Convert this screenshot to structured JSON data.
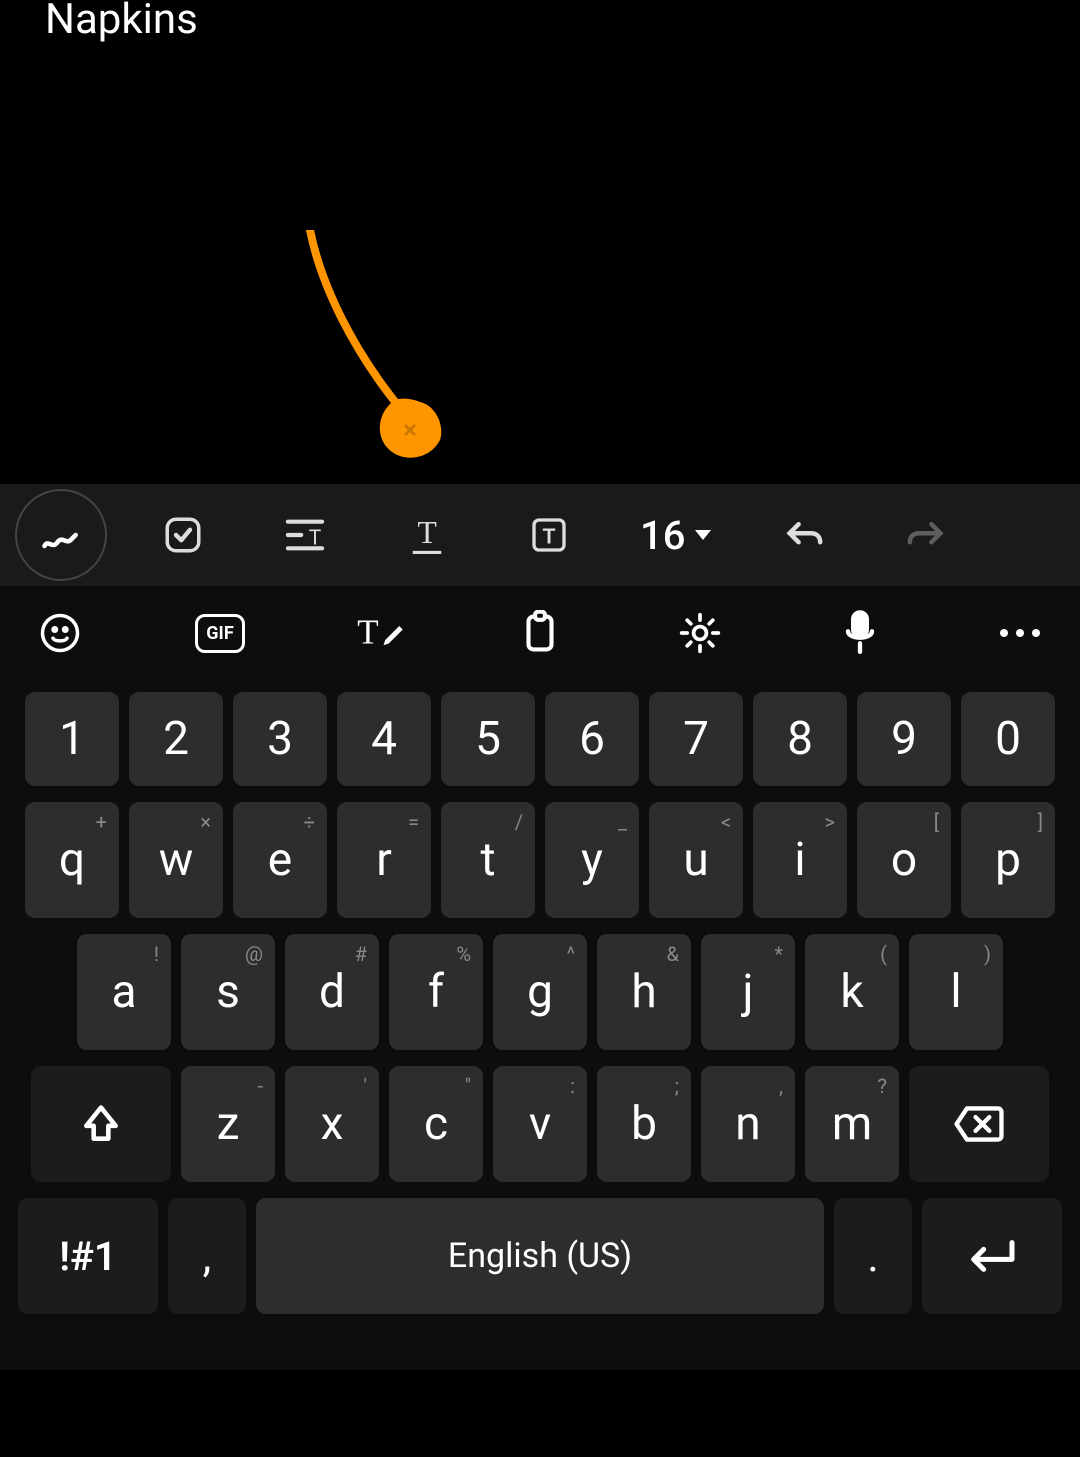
{
  "note": {
    "text": "Napkins"
  },
  "format_toolbar": {
    "font_size": "16"
  },
  "keyboard": {
    "space_label": "English (US)",
    "symbols_label": "!#1",
    "rows": {
      "numbers": [
        "1",
        "2",
        "3",
        "4",
        "5",
        "6",
        "7",
        "8",
        "9",
        "0"
      ],
      "row1": [
        {
          "main": "q",
          "sec": "+"
        },
        {
          "main": "w",
          "sec": "×"
        },
        {
          "main": "e",
          "sec": "÷"
        },
        {
          "main": "r",
          "sec": "="
        },
        {
          "main": "t",
          "sec": "/"
        },
        {
          "main": "y",
          "sec": "_"
        },
        {
          "main": "u",
          "sec": "<"
        },
        {
          "main": "i",
          "sec": ">"
        },
        {
          "main": "o",
          "sec": "["
        },
        {
          "main": "p",
          "sec": "]"
        }
      ],
      "row2": [
        {
          "main": "a",
          "sec": "!"
        },
        {
          "main": "s",
          "sec": "@"
        },
        {
          "main": "d",
          "sec": "#"
        },
        {
          "main": "f",
          "sec": "%"
        },
        {
          "main": "g",
          "sec": "^"
        },
        {
          "main": "h",
          "sec": "&"
        },
        {
          "main": "j",
          "sec": "*"
        },
        {
          "main": "k",
          "sec": "("
        },
        {
          "main": "l",
          "sec": ")"
        }
      ],
      "row3": [
        {
          "main": "z",
          "sec": "-"
        },
        {
          "main": "x",
          "sec": "'"
        },
        {
          "main": "c",
          "sec": "\""
        },
        {
          "main": "v",
          "sec": ":"
        },
        {
          "main": "b",
          "sec": ";"
        },
        {
          "main": "n",
          "sec": ","
        },
        {
          "main": "m",
          "sec": "?"
        }
      ]
    },
    "comma": ",",
    "period": "."
  }
}
